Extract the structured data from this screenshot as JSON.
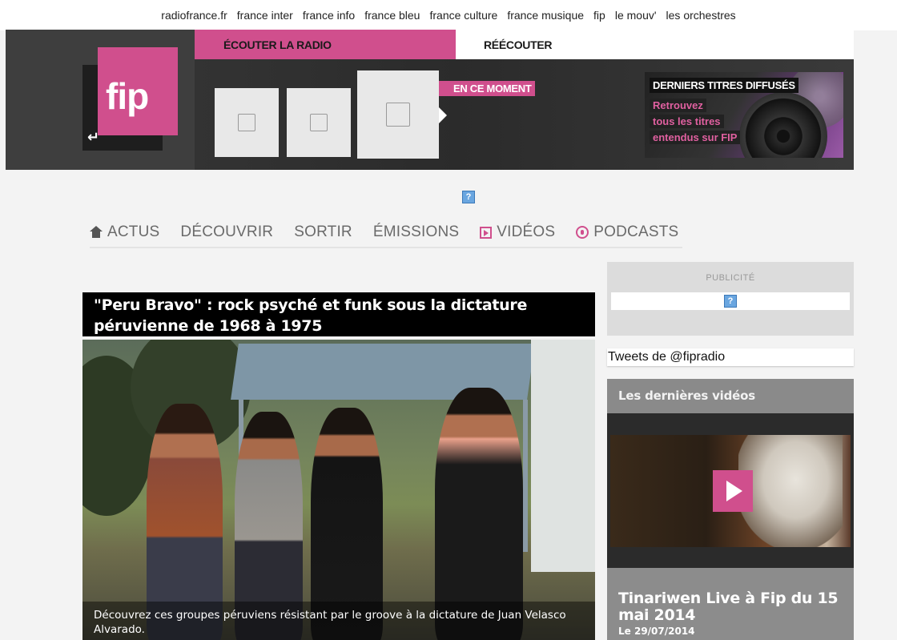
{
  "network": {
    "links": [
      "radiofrance.fr",
      "france inter",
      "france info",
      "france bleu",
      "france culture",
      "france musique",
      "fip",
      "le mouv'",
      "les orchestres"
    ]
  },
  "header": {
    "logo_text": "fip",
    "tab_listen": "ÉCOUTER LA RADIO",
    "tab_replay": "RÉÉCOUTER",
    "now_label": "EN CE MOMENT",
    "last_titles": {
      "heading": "DERNIERS TITRES DIFFUSÉS",
      "line1": "Retrouvez",
      "line2": "tous les titres",
      "line3": "entendus sur FIP"
    }
  },
  "ad_top": {
    "glyph": "?"
  },
  "nav": {
    "items": [
      "ACTUS",
      "DÉCOUVRIR",
      "SORTIR",
      "ÉMISSIONS",
      "VIDÉOS",
      "PODCASTS"
    ]
  },
  "article": {
    "title": "\"Peru Bravo\" : rock psyché et funk sous la dictature péruvienne de 1968 à 1975",
    "caption": "Découvrez ces groupes péruviens résistant par le groove à la dictature de Juan Velasco Alvarado."
  },
  "sidebar": {
    "ad_label": "PUBLICITÉ",
    "ad_glyph": "?",
    "tweets_label": "Tweets de @fipradio",
    "videos_heading": "Les dernières vidéos",
    "video_title": "Tinariwen Live à Fip du 15 mai 2014",
    "video_date": "Le 29/07/2014"
  },
  "colors": {
    "accent": "#d04f8d",
    "header_bg": "#3e3e3e"
  }
}
